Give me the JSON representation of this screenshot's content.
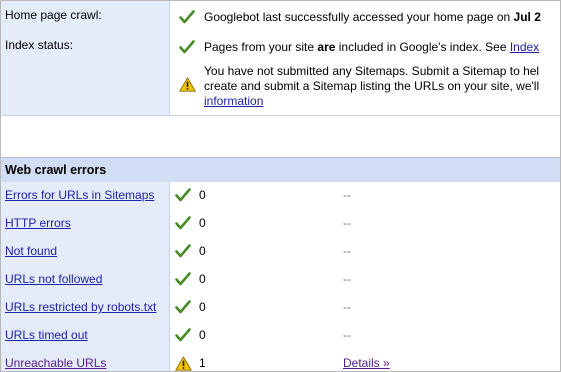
{
  "home_crawl": {
    "label": "Home page crawl:",
    "icon": "check-icon",
    "text_prefix": "Googlebot last successfully accessed your home page on ",
    "text_date": "Jul 2"
  },
  "index_status": {
    "label": "Index status:",
    "line1_prefix": "Pages from your site ",
    "line1_bold": "are",
    "line1_suffix": " included in Google's index. See ",
    "line1_link": "Index",
    "warn_line1": "You have not submitted any Sitemaps. Submit a Sitemap to hel",
    "warn_line2": "create and submit a Sitemap listing the URLs on your site, we'll",
    "warn_link": "information"
  },
  "web_crawl": {
    "title": "Web crawl errors",
    "rows": [
      {
        "label": "Errors for URLs in Sitemaps",
        "icon": "check-icon",
        "count": "0",
        "details": "--"
      },
      {
        "label": "HTTP errors",
        "icon": "check-icon",
        "count": "0",
        "details": "--"
      },
      {
        "label": "Not found",
        "icon": "check-icon",
        "count": "0",
        "details": "--"
      },
      {
        "label": "URLs not followed",
        "icon": "check-icon",
        "count": "0",
        "details": "--"
      },
      {
        "label": "URLs restricted by robots.txt",
        "icon": "check-icon",
        "count": "0",
        "details": "--"
      },
      {
        "label": "URLs timed out",
        "icon": "check-icon",
        "count": "0",
        "details": "--"
      },
      {
        "label": "Unreachable URLs",
        "icon": "warning-icon",
        "count": "1",
        "details": "Details »"
      }
    ]
  },
  "colors": {
    "label_bg": "#e5ecf9",
    "section_bg": "#d0ddf2",
    "link": "#2020aa",
    "visited_link": "#551a8b",
    "check": "#4a8a2a",
    "warning": "#f2c200"
  }
}
